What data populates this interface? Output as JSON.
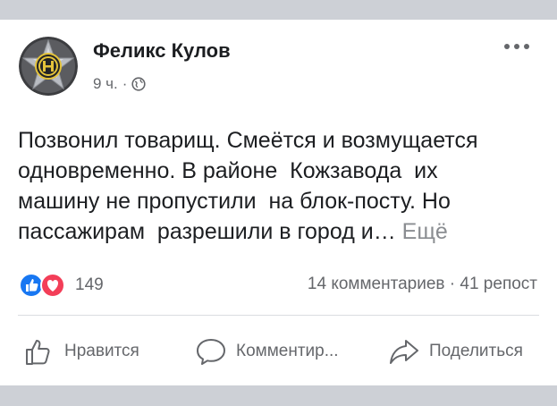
{
  "post": {
    "author": "Феликс Кулов",
    "time": "9 ч.",
    "separator": "·",
    "text_lines": [
      "Позвонил товарищ. Смеётся и возмущается",
      "одновременно. В районе  Кожзавода  их",
      "машину не пропустили  на блок-посту. Но",
      "пассажирам  разрешили в город и…"
    ],
    "see_more": "Ещё"
  },
  "engagement": {
    "reactions_count": "149",
    "stats": "14 комментариев · 41 репост"
  },
  "actions": {
    "like": "Нравится",
    "comment": "Комментир...",
    "share": "Поделиться"
  },
  "icons": {
    "more": "more-horizontal-icon",
    "privacy": "globe-icon",
    "like": "thumbs-up-icon",
    "comment": "speech-bubble-icon",
    "share": "share-arrow-icon"
  },
  "colors": {
    "like_blue": "#1877f2",
    "love_red": "#f33e58",
    "secondary_text": "#65676b",
    "text": "#1c1e21",
    "band": "#cdd0d6"
  }
}
